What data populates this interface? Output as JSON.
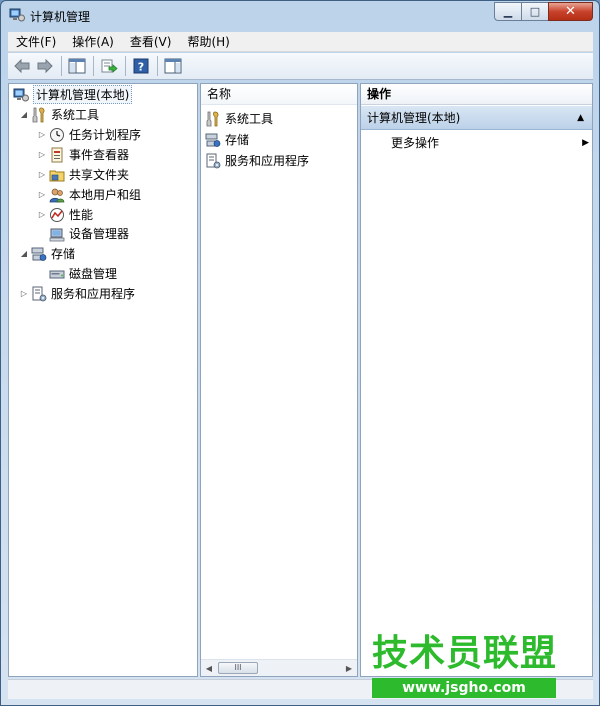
{
  "window": {
    "title": "计算机管理",
    "controls": {
      "minimize": "▁",
      "maximize": "□",
      "close": "✕"
    }
  },
  "menu": [
    "文件(F)",
    "操作(A)",
    "查看(V)",
    "帮助(H)"
  ],
  "toolbar": {
    "buttons": [
      "back-icon",
      "forward-icon",
      "show-hide-tree-icon",
      "export-list-icon",
      "help-icon",
      "show-hide-action-pane-icon"
    ]
  },
  "tree": {
    "root": "计算机管理(本地)",
    "system_tools": "系统工具",
    "task_scheduler": "任务计划程序",
    "event_viewer": "事件查看器",
    "shared_folders": "共享文件夹",
    "local_users": "本地用户和组",
    "performance": "性能",
    "device_manager": "设备管理器",
    "storage": "存储",
    "disk_management": "磁盘管理",
    "services": "服务和应用程序"
  },
  "list": {
    "header": "名称",
    "items": [
      "系统工具",
      "存储",
      "服务和应用程序"
    ],
    "scroll_thumb": "III"
  },
  "actions": {
    "header": "操作",
    "section": "计算机管理(本地)",
    "more": "更多操作"
  },
  "watermark": {
    "title": "技术员联盟",
    "url": "www.jsgho.com"
  },
  "colors": {
    "accent": "#2dbb2d",
    "title_bar": "#bcd3ea",
    "action_section": "#c9dbef"
  }
}
